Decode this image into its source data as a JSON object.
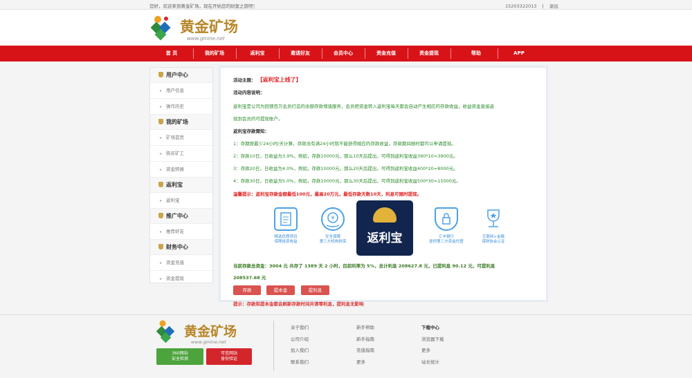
{
  "topbar": {
    "welcome": "您好，欢迎来到黄金矿场，现在开始您的财富之旅吧！",
    "phone": "15203322013",
    "divider": "|",
    "logout": "退出"
  },
  "logo": {
    "text": "黄金矿场",
    "url_text": "www.gmine.net"
  },
  "nav": [
    "首 页",
    "我的矿场",
    "返利宝",
    "邀请好友",
    "会员中心",
    "资金充值",
    "资金提现",
    "帮助",
    "APP"
  ],
  "sidebar": [
    {
      "group": "用户中心",
      "items": [
        "用户信息",
        "操作历史"
      ]
    },
    {
      "group": "我的矿场",
      "items": [
        "矿场首页",
        "购买矿工",
        "资金转换"
      ]
    },
    {
      "group": "返利宝",
      "items": [
        "返利宝"
      ]
    },
    {
      "group": "推广中心",
      "items": [
        "推荐好友"
      ]
    },
    {
      "group": "财务中心",
      "items": [
        "资金充值",
        "资金提现"
      ]
    }
  ],
  "content": {
    "topic_label": "活动主题：",
    "topic_value": "【返利宝上线了】",
    "desc_label": "活动内容说明：",
    "desc_line1": "返利宝是公司为回馈百万会员打造的余额存款增值服务，会员把资金转入返利宝每天都会自动产生相应的存款收益，收益资金直接返",
    "desc_line2": "现到会员的可提现账户。",
    "notice_label": "返利宝存款需知：",
    "notice": [
      "1：存期按最少24小时/天计算，存款没有满24小时就不能获得相应的存款收益，存款期间随时都可以申请提现。",
      "2：存款10日，日收益为3.9%，例如，存款10000元，那么10天后提出，可得到返利宝收益390*10=3900元。",
      "3：存款20日，日收益为4.0%，例如，存款10000元，那么20天后提出，可得到返利宝收益400*20=8000元。",
      "4：存款30日，日收益为5.0%，例如，存款10000元，那么30天后提出，可得到返利宝收益500*30=15000元。"
    ],
    "warm_tip": "温馨提示：返利宝存款金额最低100元，最高20万元，最低存款天数10天，利息可随时提现。",
    "features": [
      {
        "icon": "document-icon",
        "line1": "精选优质项目",
        "line2": "保障投资收益"
      },
      {
        "icon": "safe-hand-icon",
        "line1": "安全保障",
        "line2": "第三方机构担保"
      },
      {
        "icon": "shield-lock-icon",
        "line1": "汇丰银行",
        "line2": "提供第三方资金托管"
      },
      {
        "icon": "trophy-icon",
        "line1": "互联网+金融",
        "line2": "保财协会认证"
      }
    ],
    "center_badge": "返利宝",
    "stats_line1": "当前存款总资金：3004 元 共存了 1389 天 2 小时，目前利率为 5%，总计利息 208627.8 元，已提利息 90.12 元，可提利息",
    "stats_line2": "208537.68 元",
    "buttons": [
      "存款",
      "提本金",
      "提利息"
    ],
    "bottom_tip": "提示：存款和提本金都会刷新存款时间并清零利息，提利息无影响"
  },
  "footer": {
    "badge1": {
      "line1": "360网站",
      "line2": "安全检测"
    },
    "badge2": {
      "line1": "可信网站",
      "line2": "身份验证"
    },
    "col1": [
      "关于我们",
      "公司介绍",
      "加入我们",
      "联系我们"
    ],
    "col2": [
      "新手帮助",
      "新手指南",
      "充值指南",
      "更多"
    ],
    "col3_head": "下载中心",
    "col3": [
      "浏览器下载",
      "更多",
      "站长统计"
    ]
  },
  "colors": {
    "nav_bg": "#d71318",
    "accent_red": "#e02222",
    "text_green": "#2c8a2c",
    "feature_blue": "#3b8fd8",
    "badge_navy": "#11254e"
  }
}
